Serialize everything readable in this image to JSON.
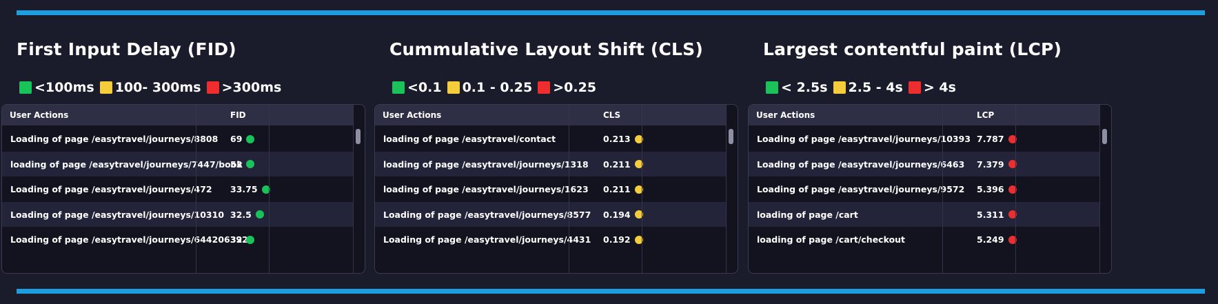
{
  "colors": {
    "green": "#19c35a",
    "yellow": "#f5cc3a",
    "red": "#ee2e2e",
    "accent": "#1d9ee0"
  },
  "panels": [
    {
      "title": "First Input Delay (FID)",
      "legend": [
        {
          "label": "<100ms",
          "color": "#19c35a"
        },
        {
          "label": "100- 300ms",
          "color": "#f5cc3a"
        },
        {
          "label": ">300ms",
          "color": "#ee2e2e"
        }
      ],
      "columns": [
        "User Actions",
        "FID"
      ],
      "rows": [
        {
          "action": "Loading of page /easytravel/journeys/8808",
          "value": "69",
          "status": "green"
        },
        {
          "action": "loading of page /easytravel/journeys/7447/book",
          "value": "53",
          "status": "green"
        },
        {
          "action": "Loading of page /easytravel/journeys/472",
          "value": "33.75",
          "status": "green"
        },
        {
          "action": "Loading of page /easytravel/journeys/10310",
          "value": "32.5",
          "status": "green"
        },
        {
          "action": "Loading of page /easytravel/journeys/644206392",
          "value": "32",
          "status": "green"
        }
      ]
    },
    {
      "title": "Cummulative Layout Shift (CLS)",
      "legend": [
        {
          "label": "<0.1",
          "color": "#19c35a"
        },
        {
          "label": "0.1 - 0.25",
          "color": "#f5cc3a"
        },
        {
          "label": ">0.25",
          "color": "#ee2e2e"
        }
      ],
      "columns": [
        "User Actions",
        "CLS"
      ],
      "rows": [
        {
          "action": "loading of page /easytravel/contact",
          "value": "0.213",
          "status": "yellow"
        },
        {
          "action": "loading of page /easytravel/journeys/1318",
          "value": "0.211",
          "status": "yellow"
        },
        {
          "action": "loading of page /easytravel/journeys/1623",
          "value": "0.211",
          "status": "yellow"
        },
        {
          "action": "Loading of page /easytravel/journeys/8577",
          "value": "0.194",
          "status": "yellow"
        },
        {
          "action": "Loading of page /easytravel/journeys/4431",
          "value": "0.192",
          "status": "yellow"
        }
      ]
    },
    {
      "title": "Largest contentful paint (LCP)",
      "legend": [
        {
          "label": "< 2.5s",
          "color": "#19c35a"
        },
        {
          "label": "2.5 - 4s",
          "color": "#f5cc3a"
        },
        {
          "label": "> 4s",
          "color": "#ee2e2e"
        }
      ],
      "columns": [
        "User Actions",
        "LCP"
      ],
      "rows": [
        {
          "action": "Loading of page /easytravel/journeys/10393",
          "value": "7.787",
          "status": "red"
        },
        {
          "action": "Loading of page /easytravel/journeys/6463",
          "value": "7.379",
          "status": "red"
        },
        {
          "action": "Loading of page /easytravel/journeys/9572",
          "value": "5.396",
          "status": "red"
        },
        {
          "action": "loading of page /cart",
          "value": "5.311",
          "status": "red"
        },
        {
          "action": "loading of page /cart/checkout",
          "value": "5.249",
          "status": "red"
        }
      ]
    }
  ]
}
